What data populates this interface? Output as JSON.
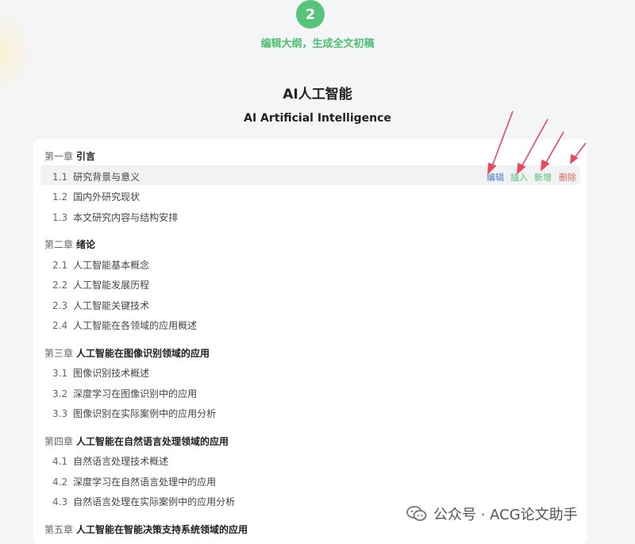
{
  "step": {
    "number": "2",
    "label": "编辑大纲，生成全文初稿"
  },
  "document": {
    "title": "AI人工智能",
    "subtitle": "AI Artificial Intelligence"
  },
  "actions": {
    "edit": "编辑",
    "insert": "插入",
    "add": "新增",
    "delete": "删除"
  },
  "chapters": [
    {
      "prefix": "第一章",
      "title": "引言"
    },
    {
      "prefix": "第二章",
      "title": "绪论"
    },
    {
      "prefix": "第三章",
      "title": "人工智能在图像识别领域的应用"
    },
    {
      "prefix": "第四章",
      "title": "人工智能在自然语言处理领域的应用"
    },
    {
      "prefix": "第五章",
      "title": "人工智能在智能决策支持系统领域的应用"
    }
  ],
  "sections": [
    {
      "num": "1.1",
      "title": "研究背景与意义"
    },
    {
      "num": "1.2",
      "title": "国内外研究现状"
    },
    {
      "num": "1.3",
      "title": "本文研究内容与结构安排"
    },
    {
      "num": "2.1",
      "title": "人工智能基本概念"
    },
    {
      "num": "2.2",
      "title": "人工智能发展历程"
    },
    {
      "num": "2.3",
      "title": "人工智能关键技术"
    },
    {
      "num": "2.4",
      "title": "人工智能在各领域的应用概述"
    },
    {
      "num": "3.1",
      "title": "图像识别技术概述"
    },
    {
      "num": "3.2",
      "title": "深度学习在图像识别中的应用"
    },
    {
      "num": "3.3",
      "title": "图像识别在实际案例中的应用分析"
    },
    {
      "num": "4.1",
      "title": "自然语言处理技术概述"
    },
    {
      "num": "4.2",
      "title": "深度学习在自然语言处理中的应用"
    },
    {
      "num": "4.3",
      "title": "自然语言处理在实际案例中的应用分析"
    }
  ],
  "watermark": {
    "text": "公众号 · ACG论文助手"
  },
  "colors": {
    "accent_green": "#56c47a",
    "edit_blue": "#4a7fd8",
    "delete_red": "#e36a5a",
    "annotation_arrow": "#e84a5a"
  }
}
